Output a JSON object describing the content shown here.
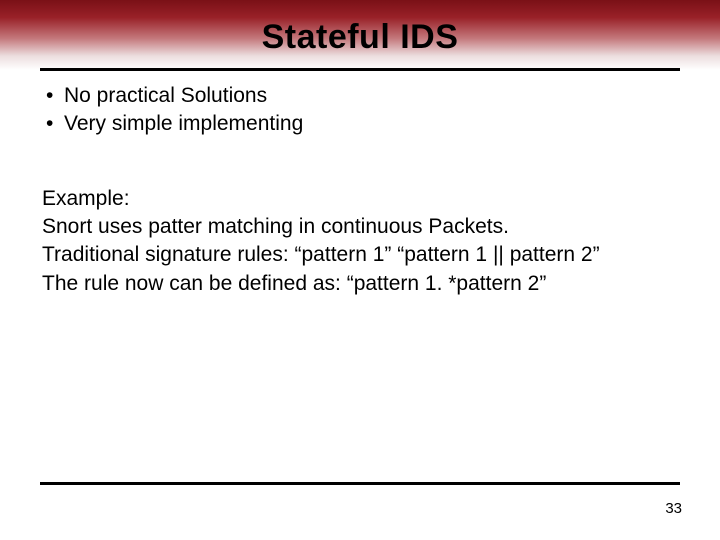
{
  "title": "Stateful IDS",
  "bullets": [
    "No practical Solutions",
    "Very simple implementing"
  ],
  "example_heading": "Example:",
  "body_lines": [
    "Snort uses patter matching in continuous Packets.",
    "Traditional signature rules: “pattern 1” “pattern 1 || pattern 2”",
    "The rule now can be defined as:  “pattern 1. *pattern 2”"
  ],
  "page_number": "33"
}
